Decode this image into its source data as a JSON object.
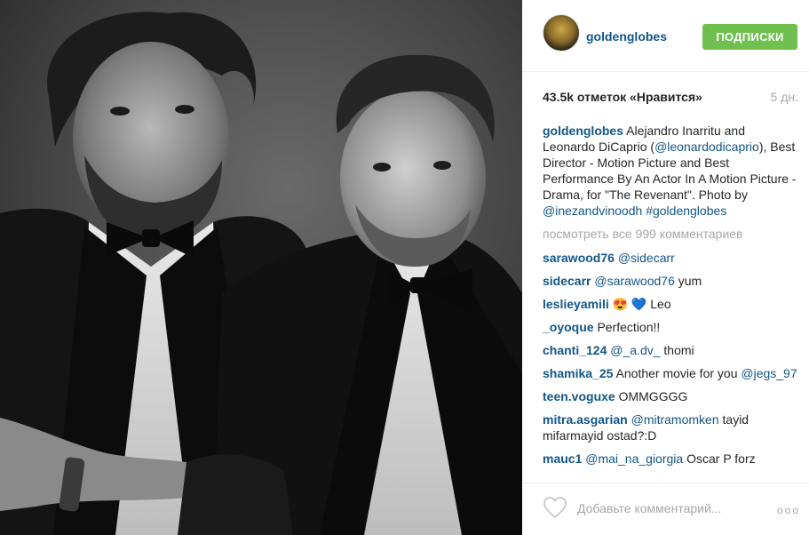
{
  "post": {
    "username": "goldenglobes",
    "follow_label": "ПОДПИСКИ",
    "likes_text": "43.5k отметок «Нравится»",
    "age_text": "5 дн."
  },
  "caption": {
    "user": "goldenglobes",
    "text_1": " Alejandro Inarritu and Leonardo DiCaprio (",
    "mention_1": "@leonardodicaprio",
    "text_2": "), Best Director - Motion Picture and Best Performance By An Actor In A Motion Picture - Drama, for \"The Revenant\". Photo by ",
    "mention_2": "@inezandvinoodh",
    "space": " ",
    "hashtag": "#goldenglobes"
  },
  "view_all": "посмотреть все 999 комментариев",
  "comments": [
    {
      "user": "sarawood76",
      "mention": "@sidecarr",
      "text": ""
    },
    {
      "user": "sidecarr",
      "mention": "@sarawood76",
      "text": " yum"
    },
    {
      "user": "leslieyamili",
      "text": " 😍 💙 Leo"
    },
    {
      "user": "_oyoque",
      "text": " Perfection!!"
    },
    {
      "user": "chanti_124",
      "mention": "@_a.dv_",
      "text": " thomi"
    },
    {
      "user": "shamika_25",
      "text": " Another movie for you ",
      "mention": "@jegs_97"
    },
    {
      "user": "teen.voguxe",
      "text": " OMMGGGG"
    },
    {
      "user": "mitra.asgarian",
      "mention": "@mitramomken",
      "text": " tayid mifarmayid ostad?:D"
    },
    {
      "user": "mauc1",
      "mention": "@mai_na_giorgia",
      "text": " Oscar P forz"
    }
  ],
  "footer": {
    "add_comment": "Добавьте комментарий...",
    "more": "ooo"
  },
  "icons": {
    "heart": "heart-icon",
    "more": "more-options-icon"
  },
  "colors": {
    "link": "#125688",
    "follow_bg": "#70c050",
    "muted": "#a5a7aa"
  }
}
